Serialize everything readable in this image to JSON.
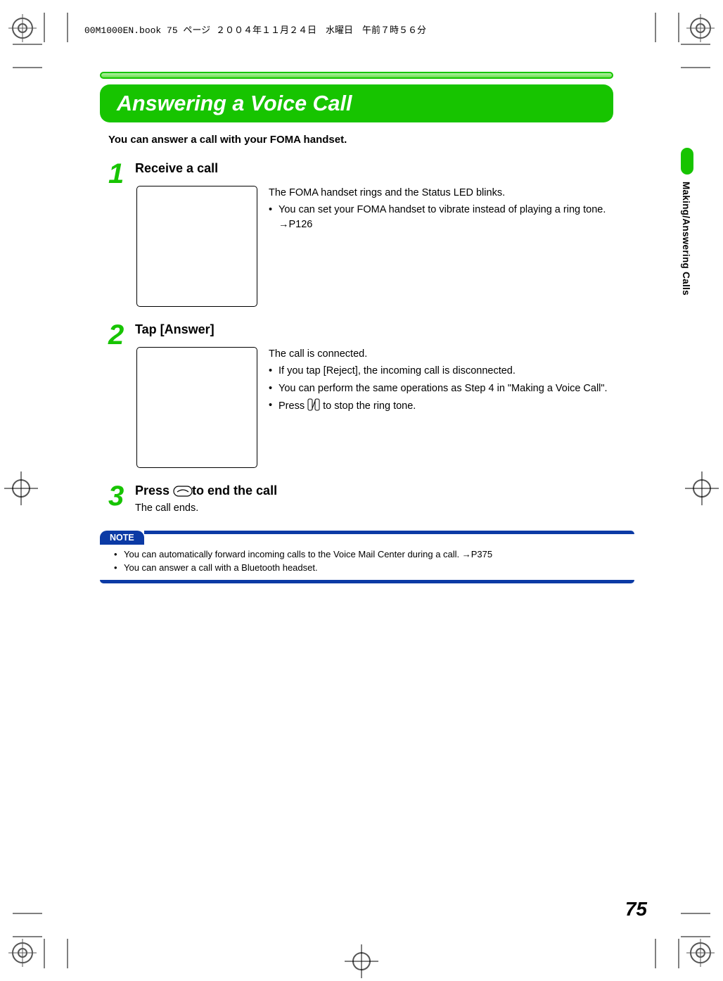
{
  "meta": {
    "header": "00M1000EN.book  75 ページ  ２００４年１１月２４日　水曜日　午前７時５６分"
  },
  "title": "Answering a Voice Call",
  "intro": "You can answer a call with your FOMA handset.",
  "steps": [
    {
      "num": "1",
      "title": "Receive a call",
      "lead": "The FOMA handset rings and the Status LED blinks.",
      "bullets": [
        "You can set your FOMA handset to vibrate instead of playing a ring tone. →P126"
      ]
    },
    {
      "num": "2",
      "title": "Tap [Answer]",
      "lead": "The call is connected.",
      "bullets": [
        "If you tap [Reject], the incoming call is disconnected.",
        "You can perform the same operations as Step 4 in \"Making a Voice Call\".",
        "Press __VOL__ to stop the ring tone."
      ]
    },
    {
      "num": "3",
      "title_prefix": "Press ",
      "title_suffix": " to end the call",
      "sub": "The call ends."
    }
  ],
  "note": {
    "label": "NOTE",
    "items": [
      "You can automatically forward incoming calls to the Voice Mail Center during a call. →P375",
      "You can answer a call with a Bluetooth headset."
    ]
  },
  "side_tab": "Making/Answering Calls",
  "page_number": "75"
}
